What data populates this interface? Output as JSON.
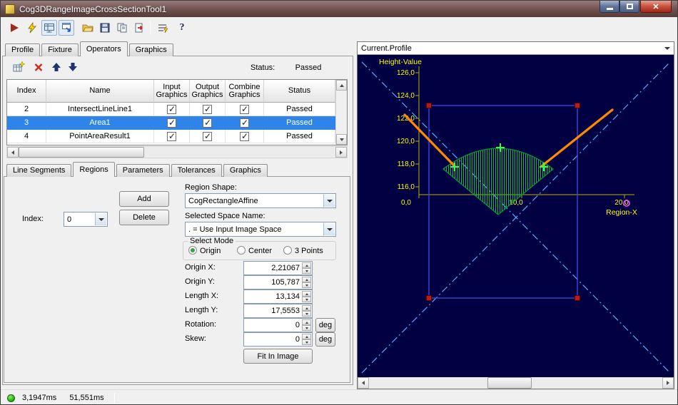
{
  "window": {
    "title": "Cog3DRangeImageCrossSectionTool1"
  },
  "toolbar": {
    "help_label": "?"
  },
  "main_tabs": {
    "items": [
      {
        "label": "Profile",
        "active": false
      },
      {
        "label": "Fixture",
        "active": false
      },
      {
        "label": "Operators",
        "active": true
      },
      {
        "label": "Graphics",
        "active": false
      }
    ]
  },
  "operators": {
    "status_label": "Status:",
    "status_value": "Passed",
    "grid": {
      "headers": [
        "Index",
        "Name",
        "Input Graphics",
        "Output Graphics",
        "Combine Graphics",
        "Status"
      ],
      "rows": [
        {
          "index": "2",
          "name": "IntersectLineLine1",
          "input_graphics": true,
          "output_graphics": true,
          "combine_graphics": true,
          "status": "Passed",
          "selected": false
        },
        {
          "index": "3",
          "name": "Area1",
          "input_graphics": true,
          "output_graphics": true,
          "combine_graphics": true,
          "status": "Passed",
          "selected": true
        },
        {
          "index": "4",
          "name": "PointAreaResult1",
          "input_graphics": true,
          "output_graphics": true,
          "combine_graphics": true,
          "status": "Passed",
          "selected": false
        }
      ]
    }
  },
  "sub_tabs": {
    "items": [
      {
        "label": "Line Segments",
        "active": false
      },
      {
        "label": "Regions",
        "active": true
      },
      {
        "label": "Parameters",
        "active": false
      },
      {
        "label": "Tolerances",
        "active": false
      },
      {
        "label": "Graphics",
        "active": false
      }
    ]
  },
  "regions": {
    "index_label": "Index:",
    "index_value": "0",
    "add_button": "Add",
    "delete_button": "Delete",
    "region_shape_label": "Region Shape:",
    "region_shape_value": "CogRectangleAffine",
    "space_name_label": "Selected Space Name:",
    "space_name_value": ". = Use Input Image Space",
    "select_mode_label": "Select Mode",
    "modes": [
      {
        "label": "Origin",
        "selected": true
      },
      {
        "label": "Center",
        "selected": false
      },
      {
        "label": "3 Points",
        "selected": false
      }
    ],
    "fields": [
      {
        "label": "Origin X:",
        "value": "2,21067"
      },
      {
        "label": "Origin Y:",
        "value": "105,787"
      },
      {
        "label": "Length X:",
        "value": "13,134"
      },
      {
        "label": "Length Y:",
        "value": "17,5553"
      },
      {
        "label": "Rotation:",
        "value": "0",
        "unit": "deg"
      },
      {
        "label": "Skew:",
        "value": "0",
        "unit": "deg"
      }
    ],
    "fit_button": "Fit In Image"
  },
  "display": {
    "header": "Current.Profile",
    "chart": {
      "y_axis_label": "Height-Value",
      "x_axis_label": "Region-X",
      "y_ticks": [
        "126,0",
        "124,0",
        "122,0",
        "120,0",
        "118,0",
        "116,0"
      ],
      "x_ticks": [
        "0,0",
        "10,0",
        "20,0"
      ],
      "colors": {
        "background": "#000042",
        "axis": "#b5b500",
        "labels": "#ffff00",
        "profile": "#ff8a00",
        "region_fill": "#00c03c",
        "region_outline": "#00a030",
        "region_rect": "#3a46d4",
        "handles": "#c01818",
        "crosses": "#33ff55",
        "marker": "#ff4dff",
        "diagonals": "#4db2ff",
        "selection": "#2e84e8"
      }
    }
  },
  "status_bar": {
    "run_time": "3,1947ms",
    "total_time": "51,551ms"
  }
}
